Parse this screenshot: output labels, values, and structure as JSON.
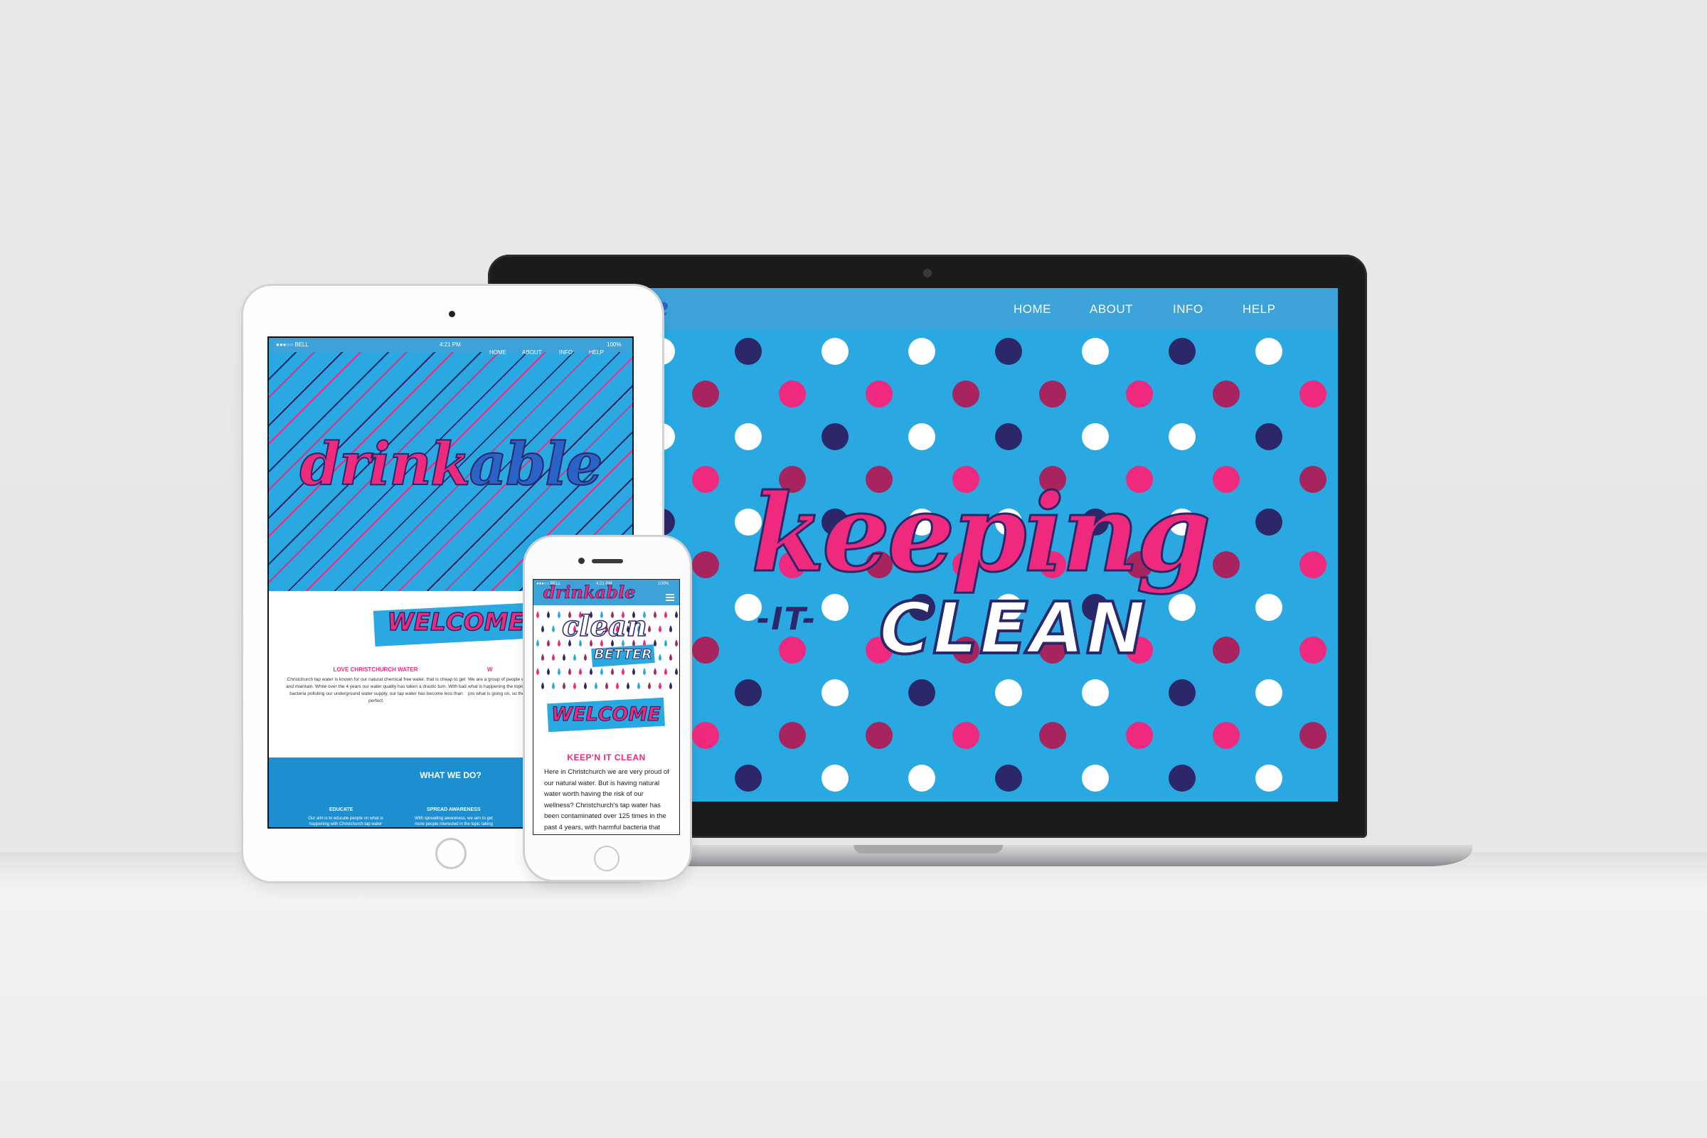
{
  "laptop": {
    "logo_fragment": "le",
    "nav": [
      "HOME",
      "ABOUT",
      "INFO",
      "HELP"
    ],
    "hero": {
      "line1": "keeping",
      "line2": "-IT-",
      "line3": "CLEAN"
    },
    "colors": {
      "sky": "#29a8e1",
      "pink": "#ef2a7e",
      "navy": "#2b2768",
      "magenta": "#a8245f",
      "white": "#ffffff"
    }
  },
  "tablet": {
    "status": {
      "carrier": "●●●○○ BELL",
      "time": "4:21 PM",
      "battery": "100%"
    },
    "nav": [
      "HOME",
      "ABOUT",
      "INFO",
      "HELP"
    ],
    "logo_pink": "drink",
    "logo_blue": "able",
    "welcome": "WELCOME",
    "col1": {
      "title": "LOVE CHRISTCHURCH WATER",
      "text": "Christchurch tap water is known for our natural chemical free water, that is cheap to get and maintain. While over the 4 years our water quality has taken a drastic turn. With bad bacteria polluting our underground water supply, our tap water has become less than perfect."
    },
    "col2": {
      "title": "W",
      "text": "We are a group of people w water up to a clean and safe people on what is happening the topic and helping clea drinkable. We want to pro what is going on, so they ch"
    },
    "what_we_do": "WHAT WE DO?",
    "sub1": {
      "title": "EDUCATE",
      "text": "Our aim is to educate people on what is happening with Christchurch tap water"
    },
    "sub2": {
      "title": "SPREAD AWARENESS",
      "text": "With spreading awareness, we aim to get more people interested in the topic taking"
    }
  },
  "phone": {
    "status": {
      "carrier": "●●●○○ BELL",
      "time": "4:21 PM",
      "battery": "100%"
    },
    "logo": "drinkable",
    "clean": "clean",
    "better": "BETTER",
    "welcome": "WELCOME",
    "subtitle": "KEEP'N IT CLEAN",
    "body": "Here in Christchurch we are very proud of our natural water. But is having natural water worth having the risk of our wellness? Christchurch's tap water has been contaminated over 125 times in the past 4 years, with harmful bacteria that can harm our families."
  }
}
